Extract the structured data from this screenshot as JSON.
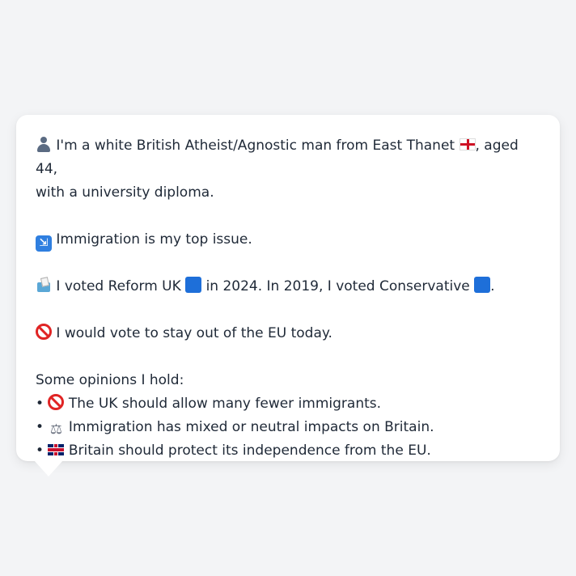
{
  "profile": {
    "line1": "I'm a white British Atheist/Agnostic man from East Thanet",
    "line1_suffix": ", aged 44,",
    "line2": "with a university diploma.",
    "top_issue": "Immigration is my top issue.",
    "vote_part1": "I voted Reform UK",
    "vote_part2": "in 2024. In 2019, I voted Conservative",
    "vote_part3": ".",
    "eu_vote": "I would vote to stay out of the EU today.",
    "opinions_heading": "Some opinions I hold:",
    "opinions": [
      "The UK should allow many fewer immigrants.",
      "Immigration has mixed or neutral impacts on Britain.",
      "Britain should protect its independence from the EU."
    ],
    "bullet": "•"
  },
  "colors": {
    "reform_uk": "#1e6fd9",
    "conservative": "#1e6fd9",
    "background": "#f3f4f6",
    "card": "#ffffff"
  },
  "icons": {
    "identity": "person-silhouette-icon",
    "location": "england-flag-icon",
    "issue": "passport-control-icon",
    "vote": "ballot-box-icon",
    "eu": "prohibited-icon",
    "opinion1": "prohibited-icon",
    "opinion2": "balance-scale-icon",
    "opinion3": "uk-flag-icon"
  }
}
